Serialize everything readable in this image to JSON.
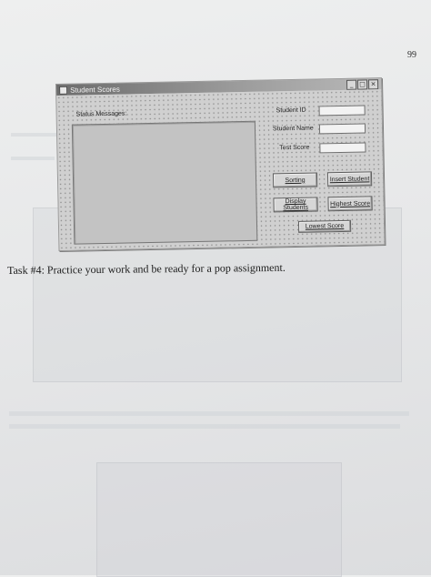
{
  "page": {
    "number": "99"
  },
  "window": {
    "title": "Student Scores",
    "controls": [
      "_",
      "□",
      "×"
    ]
  },
  "form": {
    "status_label": "Status Messages:",
    "fields": {
      "student_id_label": "Student ID",
      "student_name_label": "Student Name",
      "test_score_label": "Test Score",
      "student_id_value": "",
      "student_name_value": "",
      "test_score_value": ""
    },
    "buttons": {
      "sorting": "Sorting",
      "insert_student": "Insert Student",
      "display_students": "Display Students",
      "highest_score": "Highest Score",
      "lowest_score": "Lowest Score"
    }
  },
  "document": {
    "task_text": "Task #4: Practice your work and be ready for a pop assignment."
  },
  "colors": {
    "paper": "#e9eaeb",
    "form_background": "#d0d0d0",
    "title_bar": "#7a7a7a"
  }
}
